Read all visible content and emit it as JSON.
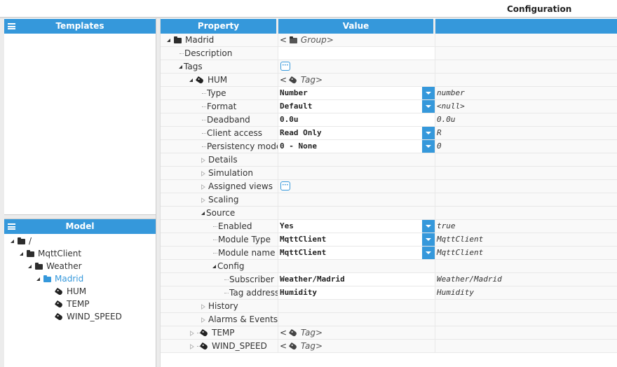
{
  "window": {
    "title": "Configuration"
  },
  "templates_panel": {
    "title": "Templates"
  },
  "model_panel": {
    "title": "Model",
    "tree": [
      {
        "label": "/",
        "type": "folder",
        "expanded": true,
        "level": 0
      },
      {
        "label": "MqttClient",
        "type": "folder",
        "expanded": true,
        "level": 1
      },
      {
        "label": "Weather",
        "type": "folder",
        "expanded": true,
        "level": 2
      },
      {
        "label": "Madrid",
        "type": "folder",
        "expanded": true,
        "level": 3,
        "selected": true
      },
      {
        "label": "HUM",
        "type": "tag",
        "level": 4
      },
      {
        "label": "TEMP",
        "type": "tag",
        "level": 4
      },
      {
        "label": "WIND_SPEED",
        "type": "tag",
        "level": 4
      }
    ]
  },
  "grid": {
    "columns": [
      "Property",
      "Value",
      ""
    ],
    "rows": {
      "madrid": {
        "property": "Madrid",
        "value": "Group"
      },
      "description": {
        "property": "Description"
      },
      "tags": {
        "property": "Tags"
      },
      "hum": {
        "property": "HUM",
        "value": "Tag"
      },
      "type": {
        "property": "Type",
        "value": "Number",
        "raw": "number"
      },
      "format": {
        "property": "Format",
        "value": "Default",
        "raw": "<null>"
      },
      "deadband": {
        "property": "Deadband",
        "value": "0.0u",
        "raw": "0.0u"
      },
      "client_access": {
        "property": "Client access",
        "value": "Read Only",
        "raw": "R"
      },
      "persistency": {
        "property": "Persistency mode",
        "value": "0 - None",
        "raw": "0"
      },
      "details": {
        "property": "Details"
      },
      "simulation": {
        "property": "Simulation"
      },
      "assigned_views": {
        "property": "Assigned views"
      },
      "scaling": {
        "property": "Scaling"
      },
      "source": {
        "property": "Source"
      },
      "enabled": {
        "property": "Enabled",
        "value": "Yes",
        "raw": "true"
      },
      "module_type": {
        "property": "Module Type",
        "value": "MqttClient",
        "raw": "MqttClient"
      },
      "module_name": {
        "property": "Module name",
        "value": "MqttClient",
        "raw": "MqttClient"
      },
      "config": {
        "property": "Config"
      },
      "subscriber": {
        "property": "Subscriber",
        "value": "Weather/Madrid",
        "raw": "Weather/Madrid"
      },
      "tag_address": {
        "property": "Tag address",
        "value": "Humidity",
        "raw": "Humidity"
      },
      "history": {
        "property": "History"
      },
      "alarms": {
        "property": "Alarms & Events"
      },
      "temp": {
        "property": "TEMP",
        "value": "Tag"
      },
      "wind_speed": {
        "property": "WIND_SPEED",
        "value": "Tag"
      }
    },
    "value_prefix": "<",
    "value_suffix": ">"
  },
  "colors": {
    "accent": "#3598db",
    "selected_text": "#3598db"
  }
}
